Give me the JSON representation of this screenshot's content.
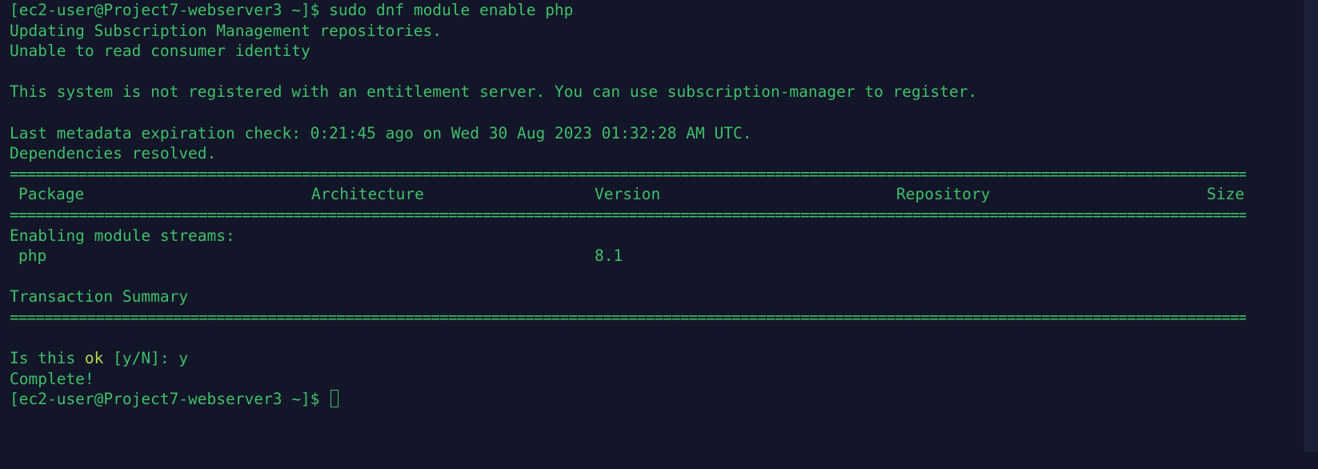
{
  "colors": {
    "background": "#131628",
    "text": "#3fbf6a",
    "highlight": "#b6d84f"
  },
  "lines": {
    "cmd_prompt": "[ec2-user@Project7-webserver3 ~]$ ",
    "cmd_text": "sudo dnf module enable php",
    "l1": "Updating Subscription Management repositories.",
    "l2": "Unable to read consumer identity",
    "l3": "This system is not registered with an entitlement server. You can use subscription-manager to register.",
    "l4": "Last metadata expiration check: 0:21:45 ago on Wed 30 Aug 2023 01:32:28 AM UTC.",
    "l5": "Dependencies resolved.",
    "separator": "==============================================================================================================================================================================",
    "l6": "Enabling module streams:",
    "l7": "Transaction Summary",
    "confirm_a": "Is this ",
    "confirm_ok": "ok",
    "confirm_b": " [y/N]: y",
    "l8": "Complete!",
    "final_prompt": "[ec2-user@Project7-webserver3 ~]$ "
  },
  "table": {
    "headers": {
      "package": "Package",
      "architecture": "Architecture",
      "version": "Version",
      "repository": "Repository",
      "size": "Size"
    },
    "rows": [
      {
        "package": "php",
        "version": "8.1"
      }
    ]
  }
}
